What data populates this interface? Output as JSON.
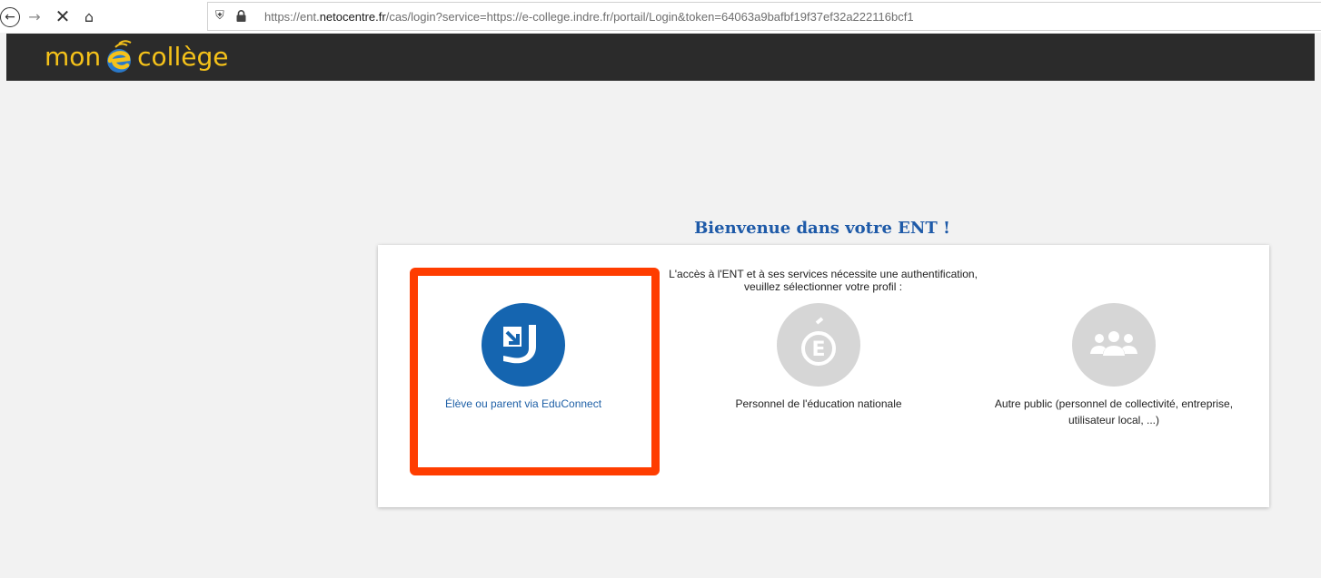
{
  "browser": {
    "url_prefix": "https://ent.",
    "url_domain": "netocentre.fr",
    "url_suffix": "/cas/login?service=https://e-college.indre.fr/portail/Login&token=64063a9bafbf19f37ef32a222116bcf1",
    "icons": {
      "back": "back-arrow-icon",
      "forward": "forward-arrow-icon",
      "stop": "stop-loading-icon",
      "home": "home-icon",
      "tracking": "shield-icon",
      "secure": "lock-icon"
    }
  },
  "header": {
    "logo_left": "mon",
    "logo_right": "collège",
    "logo_accent_color": "#f5c21a",
    "background_color": "#2b2b2b"
  },
  "main": {
    "title": "Bienvenue dans votre ENT !",
    "intro_line1": "L'accès à l'ENT et à ses services nécessite une authentification,",
    "intro_line2": "veuillez sélectionner votre profil :",
    "profiles": [
      {
        "label": "Élève ou parent via EduConnect",
        "icon": "educonnect-icon",
        "color": "#1565b0"
      },
      {
        "label": "Personnel de l'éducation nationale",
        "icon": "education-nationale-icon",
        "color": "#d6d6d6"
      },
      {
        "label_line1": "Autre public (personnel de collectivité, entreprise,",
        "label_line2": "utilisateur local, ...)",
        "icon": "group-icon",
        "color": "#d6d6d6"
      }
    ],
    "highlight_color": "#ff3d00"
  }
}
